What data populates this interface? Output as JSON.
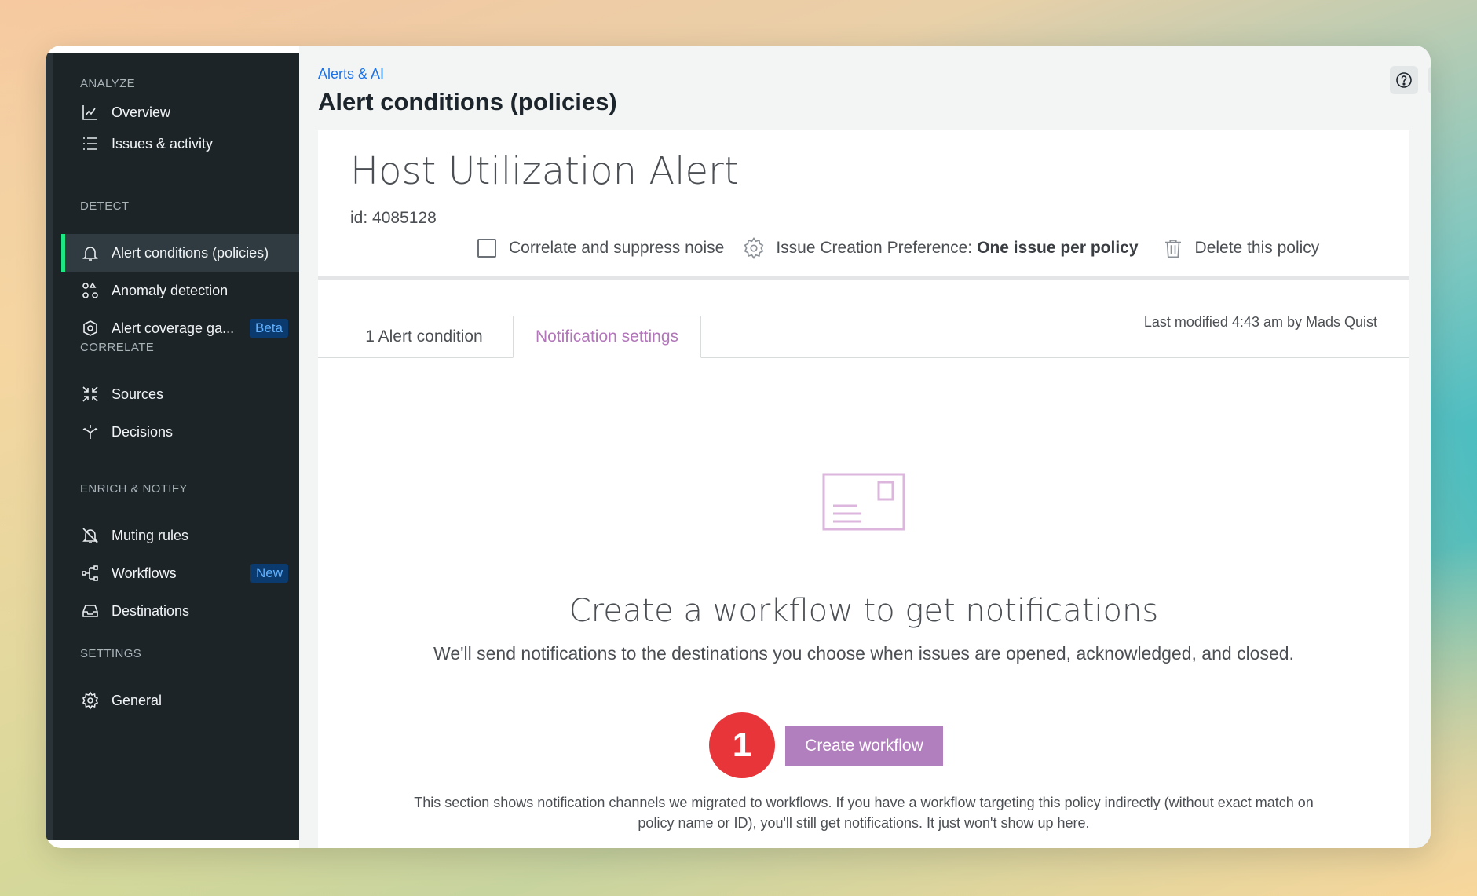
{
  "sidebar": {
    "sections": {
      "analyze": "ANALYZE",
      "detect": "DETECT",
      "correlate": "CORRELATE",
      "enrich": "ENRICH & NOTIFY",
      "settings": "SETTINGS"
    },
    "items": {
      "overview": {
        "label": "Overview",
        "icon": "chart-icon"
      },
      "issues": {
        "label": "Issues & activity",
        "icon": "list-icon"
      },
      "alert_conditions": {
        "label": "Alert conditions (policies)",
        "icon": "bell-icon"
      },
      "anomaly": {
        "label": "Anomaly detection",
        "icon": "nodes-icon"
      },
      "coverage": {
        "label": "Alert coverage ga...",
        "icon": "coverage-icon",
        "badge": "Beta"
      },
      "sources": {
        "label": "Sources",
        "icon": "sources-icon"
      },
      "decisions": {
        "label": "Decisions",
        "icon": "decisions-icon"
      },
      "muting": {
        "label": "Muting rules",
        "icon": "bell-off-icon"
      },
      "workflows": {
        "label": "Workflows",
        "icon": "workflow-icon",
        "badge": "New"
      },
      "destinations": {
        "label": "Destinations",
        "icon": "inbox-icon"
      },
      "general": {
        "label": "General",
        "icon": "gear-icon"
      }
    },
    "active_color": "#1ce783"
  },
  "header": {
    "breadcrumb": "Alerts & AI",
    "title": "Alert conditions (policies)"
  },
  "policy": {
    "name": "Host Utilization Alert",
    "id_text": "id: 4085128",
    "correlate_label": "Correlate and suppress noise",
    "pref_label": "Issue Creation Preference:",
    "pref_value": "One issue per policy",
    "delete_label": "Delete this policy"
  },
  "tabs": {
    "conditions": "1 Alert condition",
    "notifications": "Notification settings",
    "last_modified": "Last modified 4:43 am by Mads Quist"
  },
  "empty_state": {
    "title": "Create a workflow to get notifications",
    "description": "We'll send notifications to the destinations you choose when issues are opened, acknowledged, and closed.",
    "step_number": "1",
    "button": "Create workflow",
    "note": "This section shows notification channels we migrated to workflows. If you have a workflow targeting this policy indirectly (without exact match on policy name or ID), you'll still get notifications. It just won't show up here."
  },
  "colors": {
    "accent": "#b27fbe",
    "step_badge": "#e8353a",
    "link": "#1a73e8"
  }
}
